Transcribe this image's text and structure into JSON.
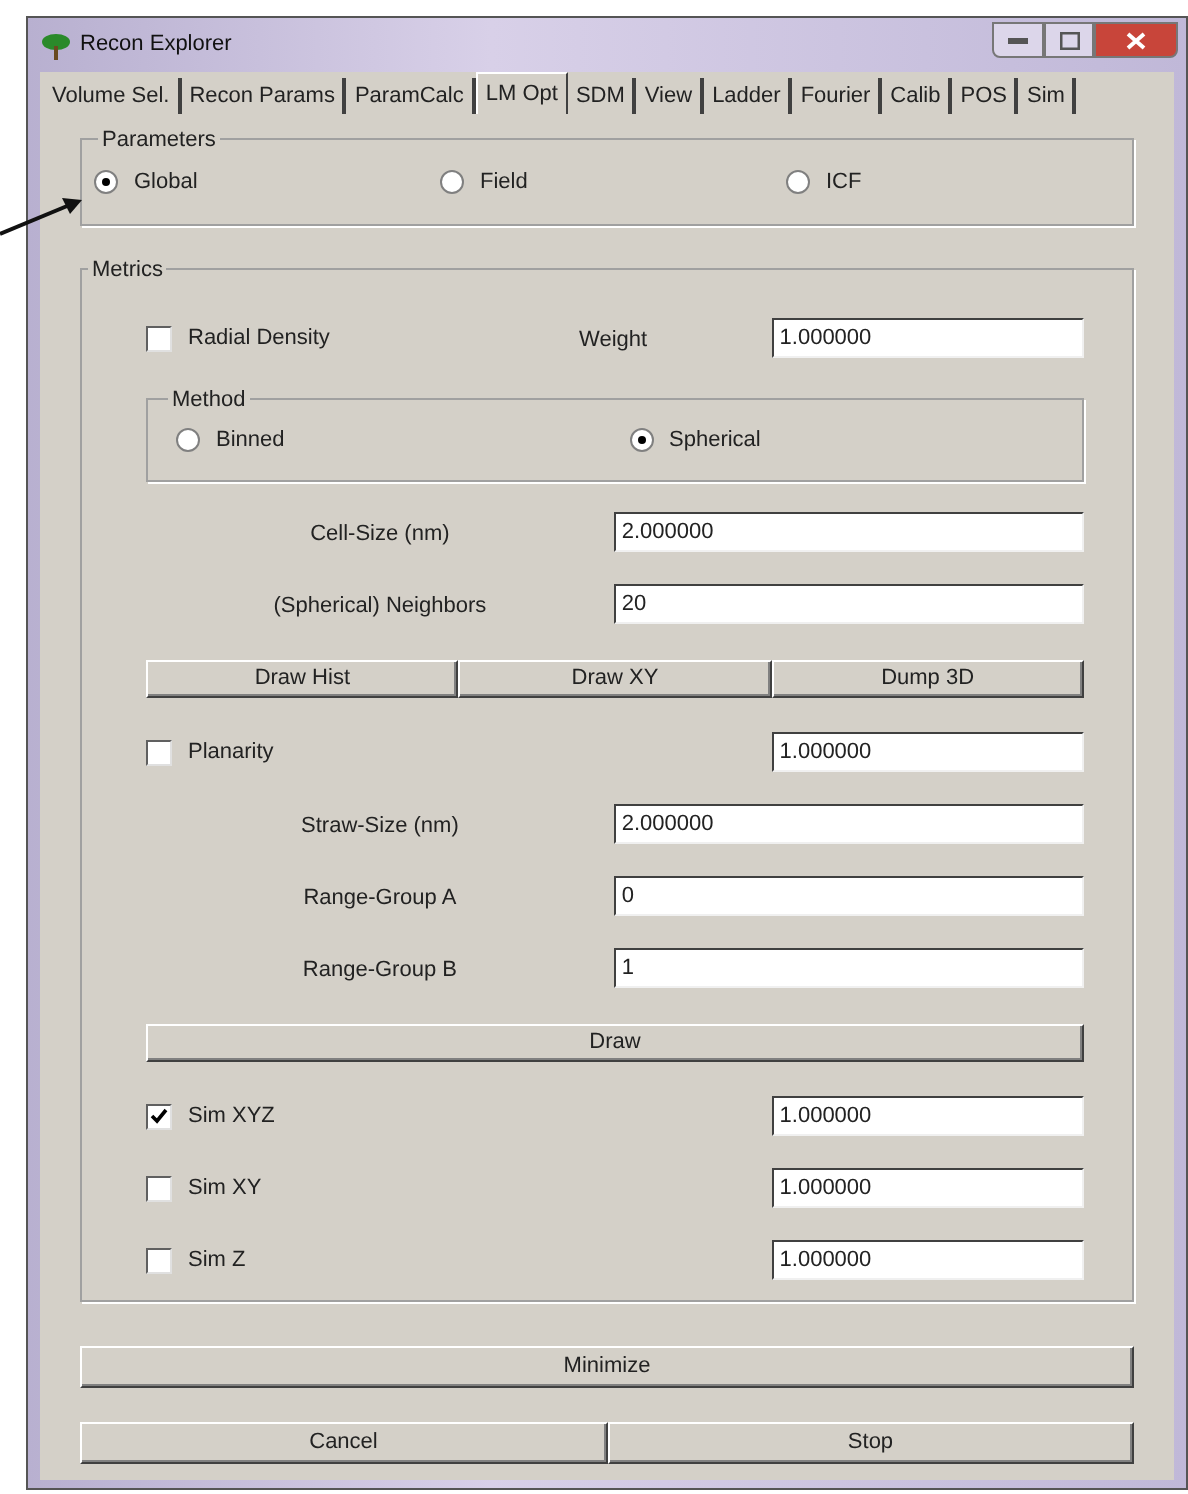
{
  "window": {
    "title": "Recon Explorer"
  },
  "tabs": [
    {
      "label": "Volume Sel.",
      "selected": false
    },
    {
      "label": "Recon Params",
      "selected": false
    },
    {
      "label": "ParamCalc",
      "selected": false
    },
    {
      "label": "LM Opt",
      "selected": true
    },
    {
      "label": "SDM",
      "selected": false
    },
    {
      "label": "View",
      "selected": false
    },
    {
      "label": "Ladder",
      "selected": false
    },
    {
      "label": "Fourier",
      "selected": false
    },
    {
      "label": "Calib",
      "selected": false
    },
    {
      "label": "POS",
      "selected": false
    },
    {
      "label": "Sim",
      "selected": false
    }
  ],
  "parameters": {
    "legend": "Parameters",
    "options": [
      {
        "label": "Global",
        "selected": true
      },
      {
        "label": "Field",
        "selected": false
      },
      {
        "label": "ICF",
        "selected": false
      }
    ]
  },
  "metrics": {
    "legend": "Metrics",
    "rows": [
      {
        "kind": "check",
        "label": "Radial Density",
        "checked": false,
        "field_label": "Weight",
        "value": "1.000000"
      },
      {
        "kind": "radiogroup",
        "legend": "Method",
        "options": [
          {
            "label": "Binned",
            "selected": false
          },
          {
            "label": "Spherical",
            "selected": true
          }
        ]
      },
      {
        "kind": "field",
        "label": "Cell-Size (nm)",
        "value": "2.000000"
      },
      {
        "kind": "field",
        "label": "(Spherical) Neighbors",
        "value": "20"
      },
      {
        "kind": "buttons",
        "buttons": [
          "Draw Hist",
          "Draw XY",
          "Dump 3D"
        ]
      },
      {
        "kind": "check",
        "label": "Planarity",
        "checked": false,
        "value": "1.000000"
      },
      {
        "kind": "field",
        "label": "Straw-Size (nm)",
        "value": "2.000000"
      },
      {
        "kind": "field",
        "label": "Range-Group A",
        "value": "0"
      },
      {
        "kind": "field",
        "label": "Range-Group B",
        "value": "1"
      },
      {
        "kind": "buttons",
        "buttons": [
          "Draw"
        ]
      },
      {
        "kind": "check",
        "label": "Sim XYZ",
        "checked": true,
        "value": "1.000000"
      },
      {
        "kind": "check",
        "label": "Sim XY",
        "checked": false,
        "value": "1.000000"
      },
      {
        "kind": "check",
        "label": "Sim Z",
        "checked": false,
        "value": "1.000000"
      }
    ]
  },
  "footer": {
    "buttons": [
      "Minimize"
    ],
    "bottom_buttons": [
      "Cancel",
      "Stop"
    ]
  }
}
